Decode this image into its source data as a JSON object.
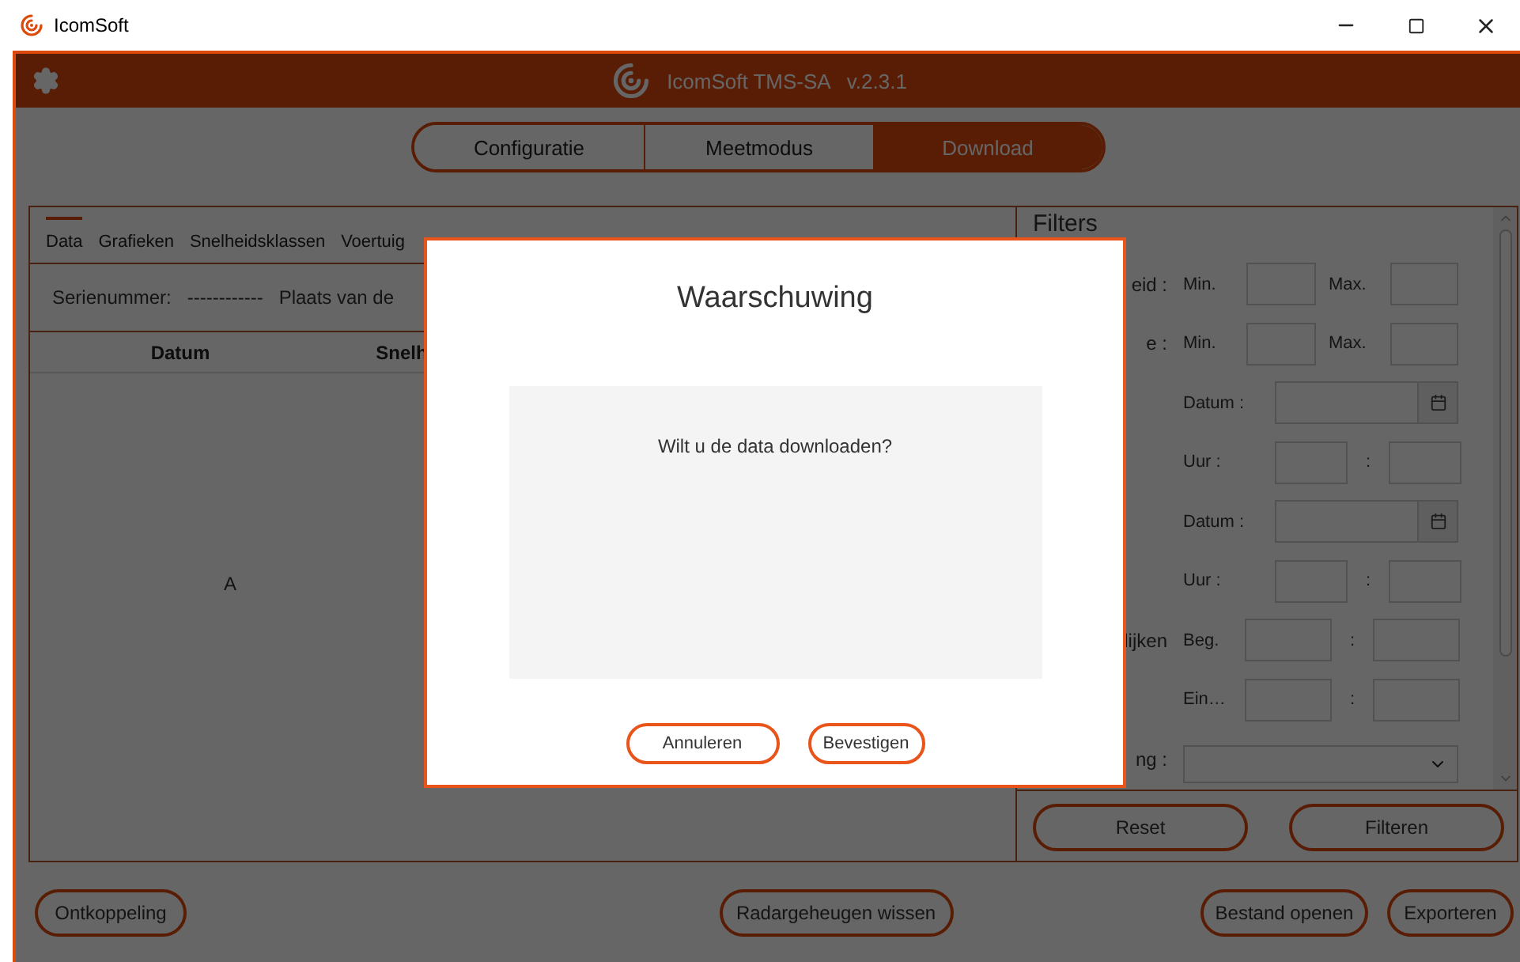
{
  "window": {
    "title": "IcomSoft"
  },
  "header": {
    "title": "IcomSoft TMS-SA",
    "version": "v.2.3.1"
  },
  "mode_tabs": [
    {
      "label": "Configuratie",
      "selected": false
    },
    {
      "label": "Meetmodus",
      "selected": false
    },
    {
      "label": "Download",
      "selected": true
    }
  ],
  "data_tabs": [
    {
      "label": "Data",
      "selected": true
    },
    {
      "label": "Grafieken",
      "selected": false
    },
    {
      "label": "Snelheidsklassen",
      "selected": false
    },
    {
      "label": "Voertuig",
      "selected": false
    }
  ],
  "info": {
    "serial_label": "Serienummer:",
    "serial_value": "------------",
    "place_label": "Plaats van de"
  },
  "table": {
    "columns": [
      "Datum",
      "Snelh"
    ],
    "empty_message": "A"
  },
  "filters": {
    "title": "Filters",
    "rows": [
      {
        "kind": "range",
        "label": "eid :",
        "min_label": "Min.",
        "max_label": "Max."
      },
      {
        "kind": "range",
        "label": "e :",
        "min_label": "Min.",
        "max_label": "Max."
      },
      {
        "kind": "date",
        "field_label": "Datum :"
      },
      {
        "kind": "time",
        "field_label": "Uur :",
        "separator": ":"
      },
      {
        "kind": "date",
        "field_label": "Datum :"
      },
      {
        "kind": "time",
        "field_label": "Uur :",
        "separator": ":"
      },
      {
        "kind": "pair",
        "label": "lijken",
        "field_label": "Beg.",
        "separator": ":"
      },
      {
        "kind": "pair",
        "field_label": "Ein…",
        "separator": ":"
      },
      {
        "kind": "select",
        "label": "ng :"
      }
    ],
    "buttons": [
      "Reset",
      "Filteren"
    ]
  },
  "footer": {
    "left": [
      "Ontkoppeling"
    ],
    "center": [
      "Radargeheugen wissen"
    ],
    "right": [
      "Bestand openen",
      "Exporteren"
    ]
  },
  "dialog": {
    "title": "Waarschuwing",
    "message": "Wilt u de data downloaden?",
    "buttons": [
      "Annuleren",
      "Bevestigen"
    ]
  }
}
